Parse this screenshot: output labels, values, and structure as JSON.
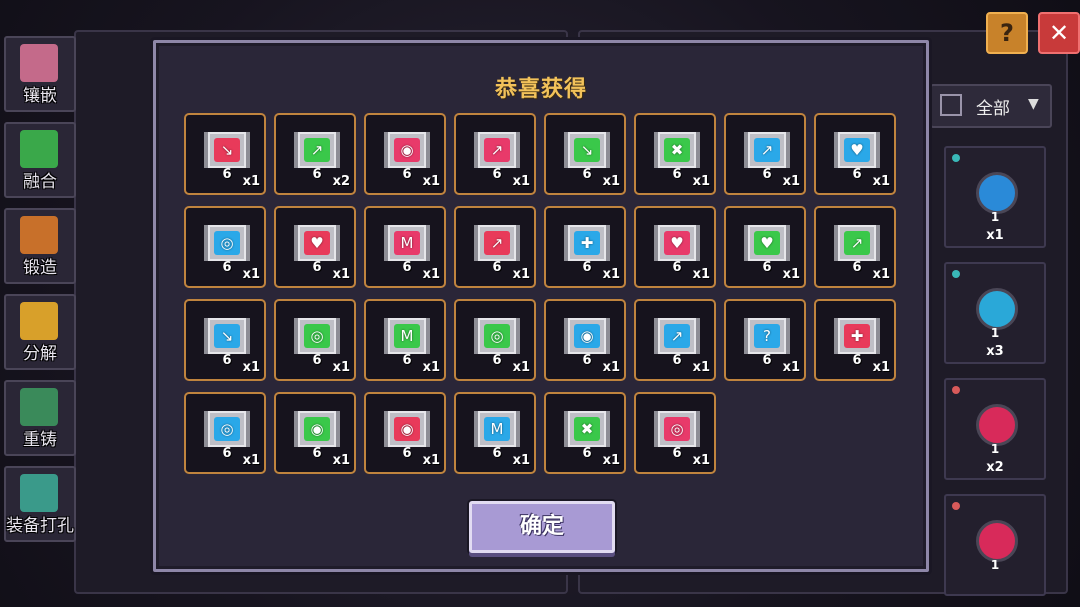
{
  "left_menu": [
    {
      "label": "镶嵌",
      "icon": "potion-icon",
      "color": "#c46a8a"
    },
    {
      "label": "融合",
      "icon": "ring-fusion-icon",
      "color": "#3aa84a"
    },
    {
      "label": "锻造",
      "icon": "chest-icon",
      "color": "#c8702a"
    },
    {
      "label": "分解",
      "icon": "cross-break-icon",
      "color": "#d8a02a"
    },
    {
      "label": "重铸",
      "icon": "bottles-icon",
      "color": "#3a8a5a"
    },
    {
      "label": "装备打孔",
      "icon": "anvil-icon",
      "color": "#3a9a8a"
    }
  ],
  "top_buttons": {
    "help": "?",
    "close": "✕"
  },
  "filter": {
    "label": "全部"
  },
  "right_list": [
    {
      "level": "1",
      "count": "x1",
      "color": "#2a8ad8",
      "dot": "#3ab8b8"
    },
    {
      "level": "1",
      "count": "x3",
      "color": "#2aa8d8",
      "dot": "#3ab8b8"
    },
    {
      "level": "1",
      "count": "x2",
      "color": "#d82a5a",
      "dot": "#d85a5a"
    },
    {
      "level": "1",
      "count": "",
      "color": "#d82a5a",
      "dot": "#d85a5a"
    }
  ],
  "modal": {
    "title": "恭喜获得",
    "confirm_label": "确定",
    "items": [
      {
        "lv": "6",
        "qty": "x1",
        "color": "#e83a5a",
        "glyph": "↘"
      },
      {
        "lv": "6",
        "qty": "x2",
        "color": "#3ac84a",
        "glyph": "↗"
      },
      {
        "lv": "6",
        "qty": "x1",
        "color": "#e83a6a",
        "glyph": "◉"
      },
      {
        "lv": "6",
        "qty": "x1",
        "color": "#e83a6a",
        "glyph": "↗"
      },
      {
        "lv": "6",
        "qty": "x1",
        "color": "#3ac84a",
        "glyph": "↘"
      },
      {
        "lv": "6",
        "qty": "x1",
        "color": "#3ac84a",
        "glyph": "✖"
      },
      {
        "lv": "6",
        "qty": "x1",
        "color": "#2aa8e8",
        "glyph": "↗"
      },
      {
        "lv": "6",
        "qty": "x1",
        "color": "#2aa8e8",
        "glyph": "♥"
      },
      {
        "lv": "6",
        "qty": "x1",
        "color": "#2aa8e8",
        "glyph": "◎"
      },
      {
        "lv": "6",
        "qty": "x1",
        "color": "#e83a5a",
        "glyph": "♥"
      },
      {
        "lv": "6",
        "qty": "x1",
        "color": "#e83a6a",
        "glyph": "M"
      },
      {
        "lv": "6",
        "qty": "x1",
        "color": "#e83a5a",
        "glyph": "↗"
      },
      {
        "lv": "6",
        "qty": "x1",
        "color": "#2aa8e8",
        "glyph": "✚"
      },
      {
        "lv": "6",
        "qty": "x1",
        "color": "#e83a6a",
        "glyph": "♥"
      },
      {
        "lv": "6",
        "qty": "x1",
        "color": "#3ac84a",
        "glyph": "♥"
      },
      {
        "lv": "6",
        "qty": "x1",
        "color": "#3ac84a",
        "glyph": "↗"
      },
      {
        "lv": "6",
        "qty": "x1",
        "color": "#2aa8e8",
        "glyph": "↘"
      },
      {
        "lv": "6",
        "qty": "x1",
        "color": "#3ac84a",
        "glyph": "◎"
      },
      {
        "lv": "6",
        "qty": "x1",
        "color": "#3ac84a",
        "glyph": "M"
      },
      {
        "lv": "6",
        "qty": "x1",
        "color": "#3ac84a",
        "glyph": "◎"
      },
      {
        "lv": "6",
        "qty": "x1",
        "color": "#2aa8e8",
        "glyph": "◉"
      },
      {
        "lv": "6",
        "qty": "x1",
        "color": "#2aa8e8",
        "glyph": "↗"
      },
      {
        "lv": "6",
        "qty": "x1",
        "color": "#2aa8e8",
        "glyph": "?"
      },
      {
        "lv": "6",
        "qty": "x1",
        "color": "#e83a5a",
        "glyph": "✚"
      },
      {
        "lv": "6",
        "qty": "x1",
        "color": "#2aa8e8",
        "glyph": "◎"
      },
      {
        "lv": "6",
        "qty": "x1",
        "color": "#3ac84a",
        "glyph": "◉"
      },
      {
        "lv": "6",
        "qty": "x1",
        "color": "#e83a5a",
        "glyph": "◉"
      },
      {
        "lv": "6",
        "qty": "x1",
        "color": "#2aa8e8",
        "glyph": "M"
      },
      {
        "lv": "6",
        "qty": "x1",
        "color": "#3ac84a",
        "glyph": "✖"
      },
      {
        "lv": "6",
        "qty": "x1",
        "color": "#e83a6a",
        "glyph": "◎"
      }
    ]
  }
}
